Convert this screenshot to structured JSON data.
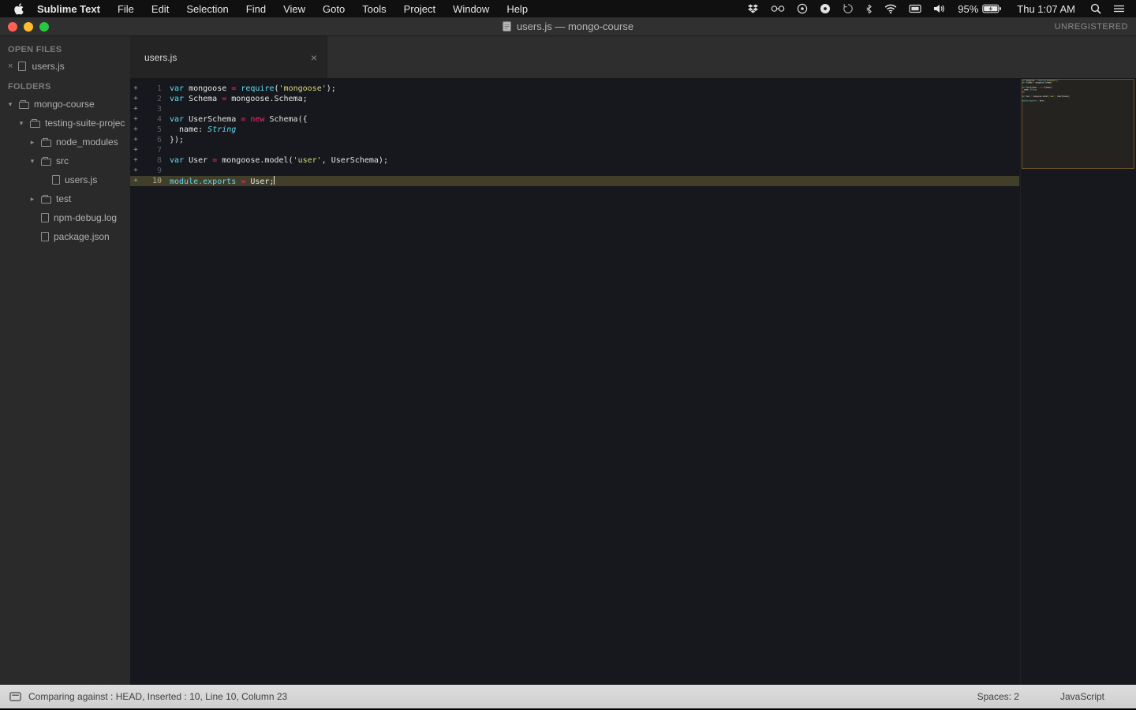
{
  "menubar": {
    "app_name": "Sublime Text",
    "items": [
      "File",
      "Edit",
      "Selection",
      "Find",
      "View",
      "Goto",
      "Tools",
      "Project",
      "Window",
      "Help"
    ],
    "battery_percent": "95%",
    "clock": "Thu 1:07 AM"
  },
  "titlebar": {
    "title": "users.js — mongo-course",
    "license": "UNREGISTERED"
  },
  "sidebar": {
    "open_files_header": "OPEN FILES",
    "open_files": [
      {
        "label": "users.js"
      }
    ],
    "folders_header": "FOLDERS",
    "tree": [
      {
        "label": "mongo-course",
        "indent": 0,
        "state": "open",
        "icon": "folder"
      },
      {
        "label": "testing-suite-projec",
        "indent": 1,
        "state": "open",
        "icon": "folder"
      },
      {
        "label": "node_modules",
        "indent": 2,
        "state": "closed",
        "icon": "folder"
      },
      {
        "label": "src",
        "indent": 2,
        "state": "open",
        "icon": "folder"
      },
      {
        "label": "users.js",
        "indent": 3,
        "state": "none",
        "icon": "file"
      },
      {
        "label": "test",
        "indent": 2,
        "state": "closed",
        "icon": "folder"
      },
      {
        "label": "npm-debug.log",
        "indent": 2,
        "state": "none",
        "icon": "file"
      },
      {
        "label": "package.json",
        "indent": 2,
        "state": "none",
        "icon": "file"
      }
    ]
  },
  "tabbar": {
    "tabs": [
      {
        "label": "users.js",
        "active": true
      }
    ]
  },
  "editor": {
    "lines": [
      {
        "num": 1,
        "diff": "+",
        "current": false,
        "segments": [
          {
            "t": "var",
            "c": "kw"
          },
          {
            "t": " mongoose ",
            "c": "fg"
          },
          {
            "t": "=",
            "c": "op"
          },
          {
            "t": " ",
            "c": "fg"
          },
          {
            "t": "require",
            "c": "fn"
          },
          {
            "t": "(",
            "c": "fg"
          },
          {
            "t": "'mongoose'",
            "c": "str"
          },
          {
            "t": ");",
            "c": "fg"
          }
        ]
      },
      {
        "num": 2,
        "diff": "+",
        "current": false,
        "segments": [
          {
            "t": "var",
            "c": "kw"
          },
          {
            "t": " Schema ",
            "c": "fg"
          },
          {
            "t": "=",
            "c": "op"
          },
          {
            "t": " mongoose.Schema;",
            "c": "fg"
          }
        ]
      },
      {
        "num": 3,
        "diff": "+",
        "current": false,
        "segments": []
      },
      {
        "num": 4,
        "diff": "+",
        "current": false,
        "segments": [
          {
            "t": "var",
            "c": "kw"
          },
          {
            "t": " UserSchema ",
            "c": "fg"
          },
          {
            "t": "=",
            "c": "op"
          },
          {
            "t": " ",
            "c": "fg"
          },
          {
            "t": "new",
            "c": "op"
          },
          {
            "t": " Schema({",
            "c": "fg"
          }
        ]
      },
      {
        "num": 5,
        "diff": "+",
        "current": false,
        "segments": [
          {
            "t": "  name: ",
            "c": "fg"
          },
          {
            "t": "String",
            "c": "type"
          }
        ]
      },
      {
        "num": 6,
        "diff": "+",
        "current": false,
        "segments": [
          {
            "t": "});",
            "c": "fg"
          }
        ]
      },
      {
        "num": 7,
        "diff": "+",
        "current": false,
        "segments": []
      },
      {
        "num": 8,
        "diff": "+",
        "current": false,
        "segments": [
          {
            "t": "var",
            "c": "kw"
          },
          {
            "t": " User ",
            "c": "fg"
          },
          {
            "t": "=",
            "c": "op"
          },
          {
            "t": " mongoose.model(",
            "c": "fg"
          },
          {
            "t": "'user'",
            "c": "str"
          },
          {
            "t": ", UserSchema);",
            "c": "fg"
          }
        ]
      },
      {
        "num": 9,
        "diff": "+",
        "current": false,
        "segments": []
      },
      {
        "num": 10,
        "diff": "+",
        "current": true,
        "segments": [
          {
            "t": "module.exports ",
            "c": "fn"
          },
          {
            "t": "=",
            "c": "op"
          },
          {
            "t": " User;",
            "c": "fg"
          }
        ]
      }
    ]
  },
  "statusbar": {
    "left": "Comparing against : HEAD, Inserted : 10, Line 10, Column 23",
    "spaces": "Spaces: 2",
    "language": "JavaScript"
  }
}
